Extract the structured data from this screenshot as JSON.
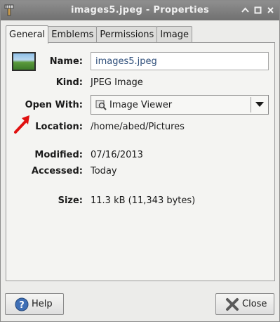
{
  "window": {
    "title": "images5.jpeg - Properties"
  },
  "tabs": [
    {
      "label": "General",
      "active": true
    },
    {
      "label": "Emblems",
      "active": false
    },
    {
      "label": "Permissions",
      "active": false
    },
    {
      "label": "Image",
      "active": false
    }
  ],
  "general": {
    "name_label": "Name:",
    "name_value": "images5.jpeg",
    "kind_label": "Kind:",
    "kind_value": "JPEG Image",
    "open_with_label": "Open With:",
    "open_with_value": "Image Viewer",
    "location_label": "Location:",
    "location_value": "/home/abed/Pictures",
    "modified_label": "Modified:",
    "modified_value": "07/16/2013",
    "accessed_label": "Accessed:",
    "accessed_value": "Today",
    "size_label": "Size:",
    "size_value": "11.3 kB (11,343 bytes)"
  },
  "buttons": {
    "help": "Help",
    "close": "Close"
  },
  "icons": {
    "app": "broom-icon",
    "thumbnail": "image-thumbnail",
    "open_with": "image-viewer-icon",
    "help": "help-icon",
    "close": "close-x-icon",
    "annotation": "red-arrow-annotation"
  },
  "colors": {
    "titlebar": "#7a7a7a",
    "annotation_arrow": "#e01010",
    "name_text": "#2e4e7a"
  }
}
